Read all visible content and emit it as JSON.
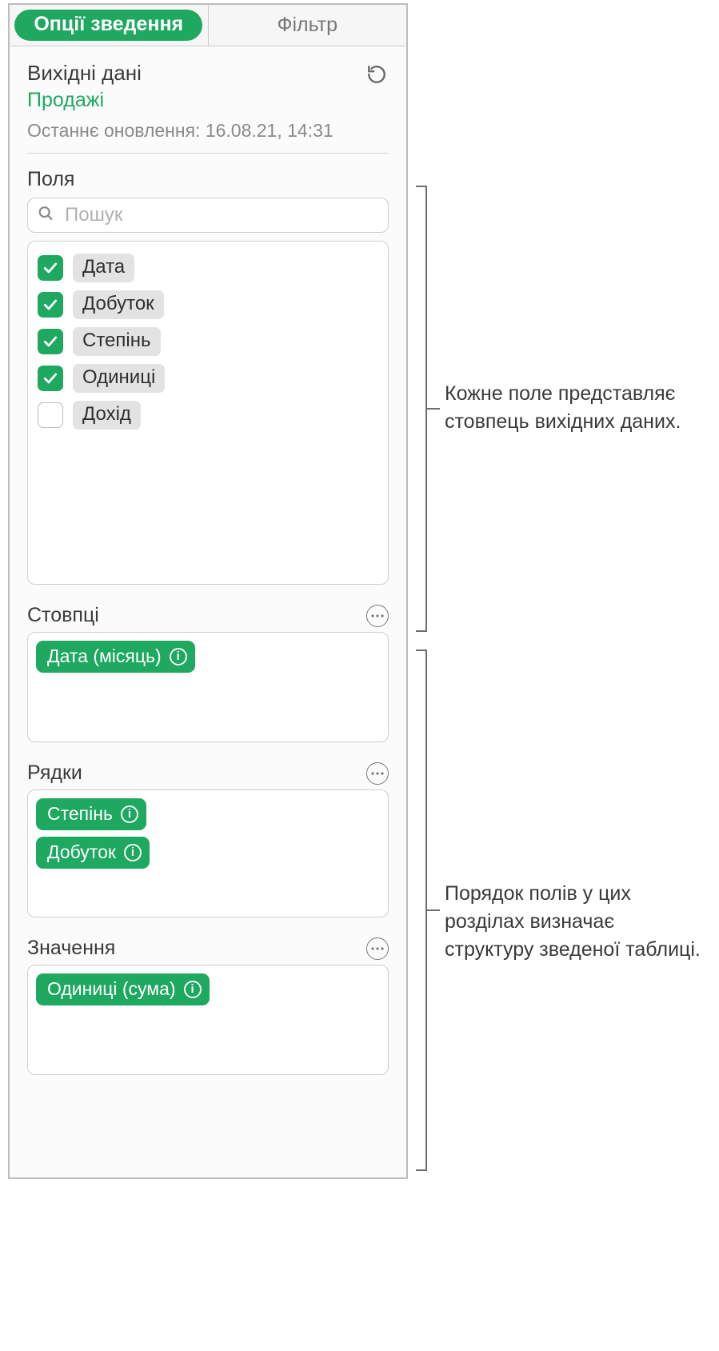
{
  "tabs": {
    "pivot": "Опції зведення",
    "filter": "Фільтр"
  },
  "source": {
    "title": "Вихідні дані",
    "name": "Продажі",
    "updated": "Останнє оновлення: 16.08.21, 14:31"
  },
  "fields": {
    "label": "Поля",
    "search_placeholder": "Пошук",
    "items": [
      {
        "label": "Дата",
        "checked": true
      },
      {
        "label": "Добуток",
        "checked": true
      },
      {
        "label": "Степінь",
        "checked": true
      },
      {
        "label": "Одиниці",
        "checked": true
      },
      {
        "label": "Дохід",
        "checked": false
      }
    ]
  },
  "zones": {
    "columns": {
      "title": "Стовпці",
      "tokens": [
        "Дата (місяць)"
      ]
    },
    "rows": {
      "title": "Рядки",
      "tokens": [
        "Степінь",
        "Добуток"
      ]
    },
    "values": {
      "title": "Значення",
      "tokens": [
        "Одиниці (сума)"
      ]
    }
  },
  "callouts": {
    "fields": "Кожне поле представляє стовпець вихідних даних.",
    "zones": "Порядок полів у цих розділах визначає структуру зведеної таблиці."
  }
}
